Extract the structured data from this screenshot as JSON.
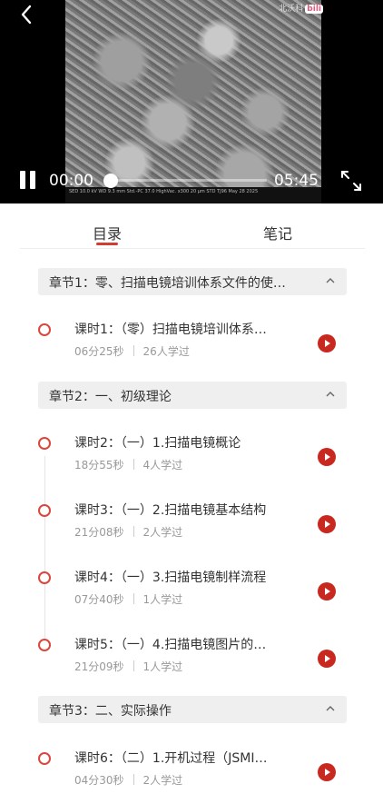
{
  "video": {
    "watermark_text": "北沃科",
    "watermark_logo": "bili",
    "sem_info": "SED   10.0 kV   WD 9.3 mm   Std.-PC 37.0   HighVac.   x300        20 μm      STD   TJ96   May 28 2025",
    "current_time": "00:00",
    "duration": "05:45",
    "progress": 0.0
  },
  "tabs": {
    "toc": "目录",
    "notes": "笔记"
  },
  "chapters": [
    {
      "title": "章节1：零、扫描电镜培训体系文件的使…",
      "lessons": [
        {
          "title": "课时1：（零）扫描电镜培训体系…",
          "duration": "06分25秒",
          "learners": "26人学过"
        }
      ]
    },
    {
      "title": "章节2：一、初级理论",
      "lessons": [
        {
          "title": "课时2：（一）1.扫描电镜概论",
          "duration": "18分55秒",
          "learners": "4人学过"
        },
        {
          "title": "课时3：（一）2.扫描电镜基本结构",
          "duration": "21分08秒",
          "learners": "2人学过"
        },
        {
          "title": "课时4：（一）3.扫描电镜制样流程",
          "duration": "07分40秒",
          "learners": "1人学过"
        },
        {
          "title": "课时5：（一）4.扫描电镜图片的…",
          "duration": "21分09秒",
          "learners": "1人学过"
        }
      ]
    },
    {
      "title": "章节3：二、实际操作",
      "lessons": [
        {
          "title": "课时6：（二）1.开机过程（JSMI…",
          "duration": "04分30秒",
          "learners": "2人学过"
        }
      ]
    }
  ],
  "colors": {
    "accent": "#d23c33",
    "play": "#c8281f",
    "chapter_bg": "#efefef"
  },
  "icons": {
    "back": "back-arrow-icon",
    "pause": "pause-icon",
    "fullscreen": "fullscreen-icon",
    "chevron": "chevron-up-icon",
    "play": "play-icon",
    "dot": "status-circle-icon"
  }
}
